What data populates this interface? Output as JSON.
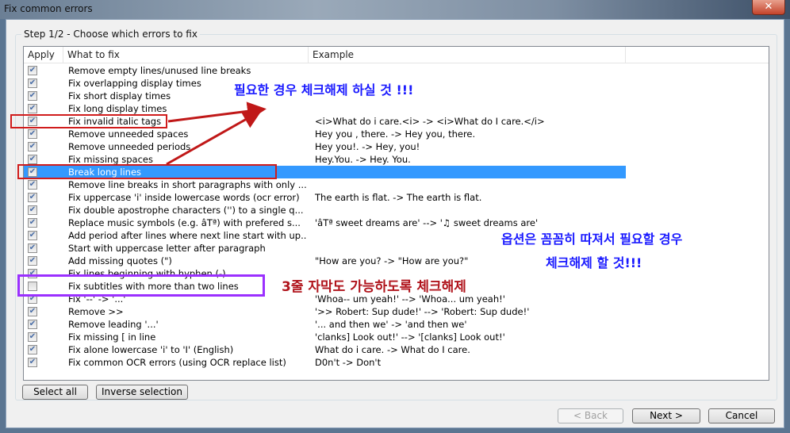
{
  "window": {
    "title": "Fix common errors",
    "close": "✕"
  },
  "group_label": "Step 1/2 - Choose which errors to fix",
  "columns": [
    "Apply",
    "What to fix",
    "Example"
  ],
  "rows": [
    {
      "checked": true,
      "fix": "Remove empty lines/unused line breaks",
      "example": ""
    },
    {
      "checked": true,
      "fix": "Fix overlapping display times",
      "example": ""
    },
    {
      "checked": true,
      "fix": "Fix short display times",
      "example": ""
    },
    {
      "checked": true,
      "fix": "Fix long display times",
      "example": ""
    },
    {
      "checked": true,
      "fix": "Fix invalid italic tags",
      "example": "<i>What do i care.<i> -> <i>What do I care.</i>"
    },
    {
      "checked": true,
      "fix": "Remove unneeded spaces",
      "example": "Hey   you , there. -> Hey you, there."
    },
    {
      "checked": true,
      "fix": "Remove unneeded periods",
      "example": "Hey you!. -> Hey, you!"
    },
    {
      "checked": true,
      "fix": "Fix missing spaces",
      "example": "Hey.You. -> Hey. You."
    },
    {
      "checked": true,
      "fix": "Break long lines",
      "example": "",
      "selected": true
    },
    {
      "checked": true,
      "fix": "Remove line breaks in short paragraphs with only ...",
      "example": ""
    },
    {
      "checked": true,
      "fix": "Fix uppercase 'i' inside lowercase words (ocr error)",
      "example": "The earth is flat. -> The earth is flat."
    },
    {
      "checked": true,
      "fix": "Fix double apostrophe characters ('') to a single q...",
      "example": ""
    },
    {
      "checked": true,
      "fix": "Replace music symbols (e.g. âTª) with prefered s...",
      "example": "'âTª sweet dreams are' --> '♫ sweet dreams are'"
    },
    {
      "checked": true,
      "fix": "Add period after lines where next line start with up...",
      "example": ""
    },
    {
      "checked": true,
      "fix": "Start with uppercase letter after paragraph",
      "example": ""
    },
    {
      "checked": true,
      "fix": "Add missing quotes (\")",
      "example": "\"How are you? -> \"How are you?\""
    },
    {
      "checked": true,
      "fix": "Fix lines beginning with hyphen (-)",
      "example": ""
    },
    {
      "checked": false,
      "fix": "Fix subtitles with more than two lines",
      "example": ""
    },
    {
      "checked": true,
      "fix": "Fix '--' -> '...'",
      "example": "'Whoa-- um yeah!' --> 'Whoa... um yeah!'"
    },
    {
      "checked": true,
      "fix": "Remove >>",
      "example": "'>> Robert: Sup dude!' --> 'Robert: Sup dude!'"
    },
    {
      "checked": true,
      "fix": "Remove leading '...'",
      "example": "'... and then we' -> 'and then we'"
    },
    {
      "checked": true,
      "fix": "Fix missing [ in line",
      "example": "'clanks] Look out!' --> '[clanks] Look out!'"
    },
    {
      "checked": true,
      "fix": "Fix alone lowercase 'i' to 'I' (English)",
      "example": "What do i care. -> What do I care."
    },
    {
      "checked": true,
      "fix": "Fix common OCR errors (using OCR replace list)",
      "example": "D0n't -> Don't"
    }
  ],
  "buttons": {
    "select_all": "Select all",
    "inverse": "Inverse selection",
    "back": "< Back",
    "next": "Next >",
    "cancel": "Cancel"
  },
  "annotations": {
    "top": "필요한 경우 체크해제 하실 것 !!!",
    "right_1": "옵션은 꼼꼼히 따져서 필요할 경우",
    "right_2": "체크해제 할 것!!!",
    "middle": "3줄 자막도 가능하도록 체크해제"
  },
  "colors": {
    "selection": "#3399ff",
    "annotation_blue": "#1a1aff",
    "annotation_red": "#b0141c",
    "highlight_purple": "#9b30ff"
  }
}
